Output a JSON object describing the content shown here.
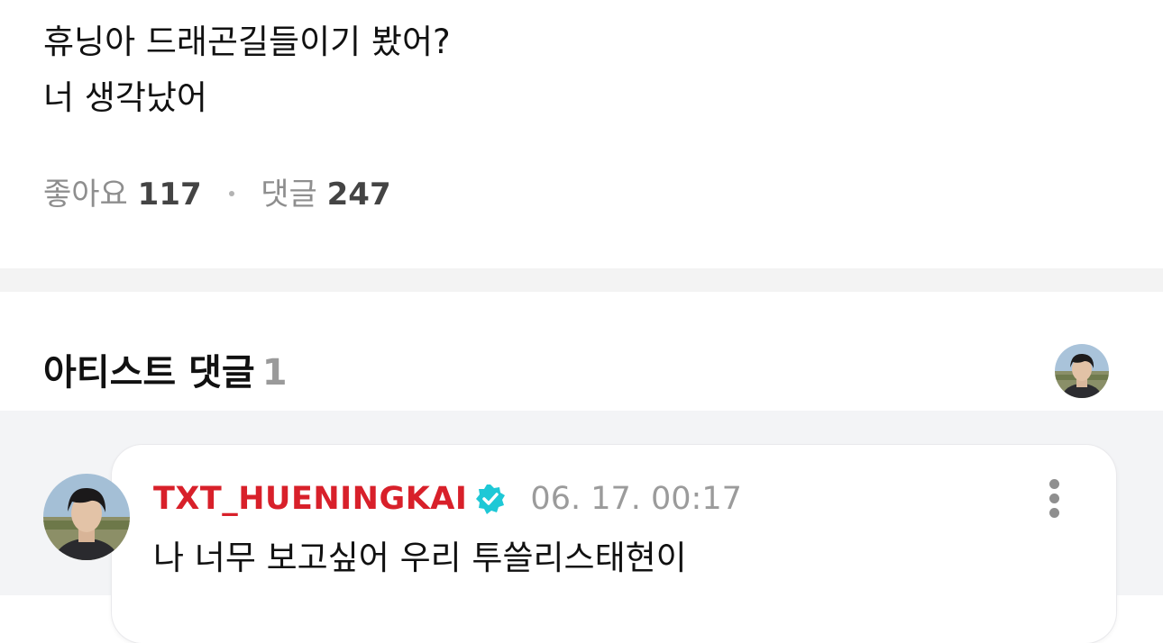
{
  "post": {
    "body_lines": [
      "휴닝아 드래곤길들이기 봤어?",
      "너 생각났어"
    ],
    "likes_label": "좋아요",
    "likes_count": "117",
    "comments_label": "댓글",
    "comments_count": "247"
  },
  "artist_section": {
    "title": "아티스트 댓글",
    "count": "1"
  },
  "comment": {
    "username": "TXT_HUENINGKAI",
    "timestamp": "06. 17. 00:17",
    "text": "나 너무 보고싶어 우리 투쓸리스태현이"
  },
  "icons": {
    "verified": "verified-badge-icon",
    "more": "more-vertical-icon"
  },
  "colors": {
    "username": "#d8202a",
    "verified_badge": "#1ec8d6",
    "muted_text": "#9b9b9b",
    "page_bg": "#ffffff",
    "section_bg": "#f3f4f6"
  }
}
